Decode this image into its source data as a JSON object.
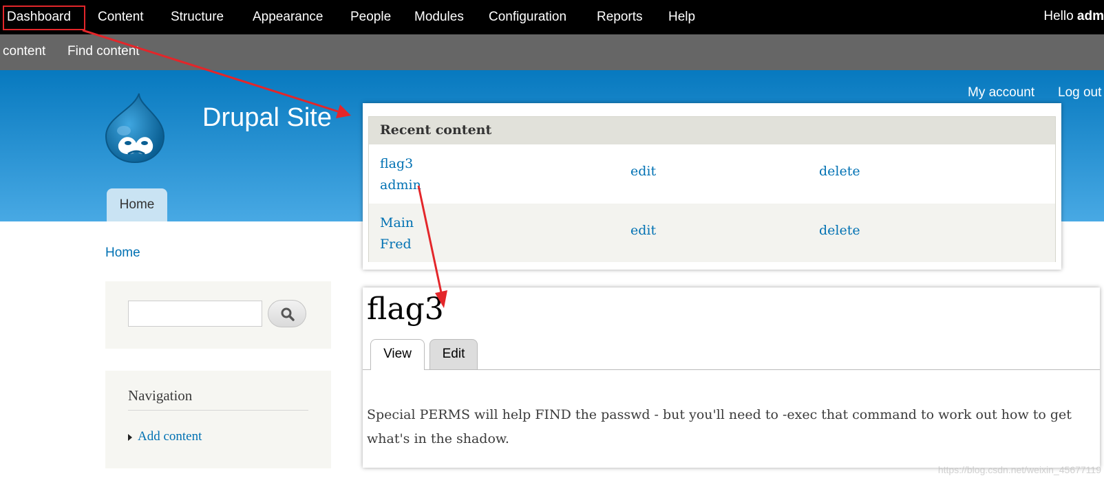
{
  "toolbar": {
    "items": [
      "Dashboard",
      "Content",
      "Structure",
      "Appearance",
      "People",
      "Modules",
      "Configuration",
      "Reports",
      "Help"
    ],
    "hello_prefix": "Hello ",
    "hello_user": "adm"
  },
  "shortcuts": {
    "items": [
      "content",
      "Find content"
    ]
  },
  "header": {
    "my_account": "My account",
    "log_out": "Log out",
    "site_name": "Drupal Site",
    "home_tab": "Home"
  },
  "breadcrumb": "Home",
  "search": {
    "value": ""
  },
  "navigation": {
    "title": "Navigation",
    "items": [
      "Add content"
    ]
  },
  "recent_content": {
    "title": "Recent content",
    "rows": [
      {
        "title": "flag3",
        "author": "admin",
        "edit": "edit",
        "delete": "delete"
      },
      {
        "title": "Main",
        "author": "Fred",
        "edit": "edit",
        "delete": "delete"
      }
    ]
  },
  "node": {
    "title": "flag3",
    "tabs": [
      "View",
      "Edit"
    ],
    "active_tab": "View",
    "body": "Special PERMS will help FIND the passwd - but you'll need to -exec that command to work out how to get what's in the shadow."
  },
  "watermark": "https://blog.csdn.net/weixin_45677119",
  "colors": {
    "link": "#0071b3",
    "annotation_red": "#e3262a",
    "header_top": "#0779bf",
    "header_bottom": "#48a9e4"
  }
}
